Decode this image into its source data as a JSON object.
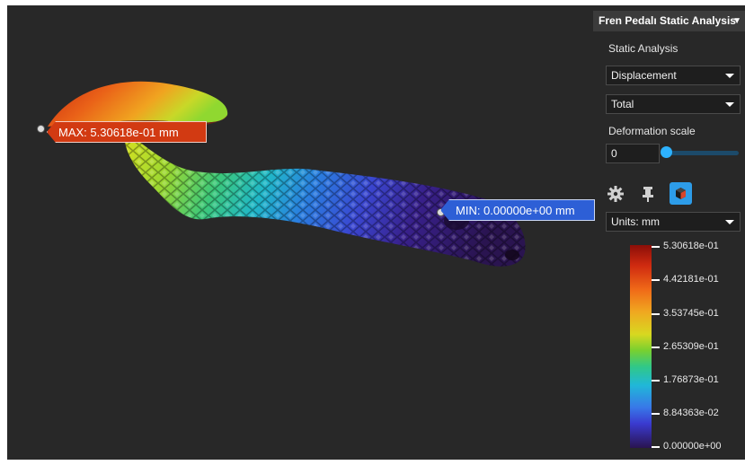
{
  "panel": {
    "title": "Fren Pedalı Static Analysis",
    "analysis_type_label": "Static Analysis",
    "result_dropdown": "Displacement",
    "component_dropdown": "Total",
    "deformation_scale_label": "Deformation scale",
    "deformation_scale_value": "0",
    "units_dropdown": "Units: mm",
    "accent_color": "#2db2ff"
  },
  "viewport": {
    "max_callout": "MAX: 5.30618e-01 mm",
    "min_callout": "MIN: 0.00000e+00 mm"
  },
  "legend": {
    "labels": [
      "5.30618e-01",
      "4.42181e-01",
      "3.53745e-01",
      "2.65309e-01",
      "1.76873e-01",
      "8.84363e-02",
      "0.00000e+00"
    ]
  },
  "icons": [
    "gear-icon",
    "pin-icon",
    "cube-display-icon"
  ]
}
